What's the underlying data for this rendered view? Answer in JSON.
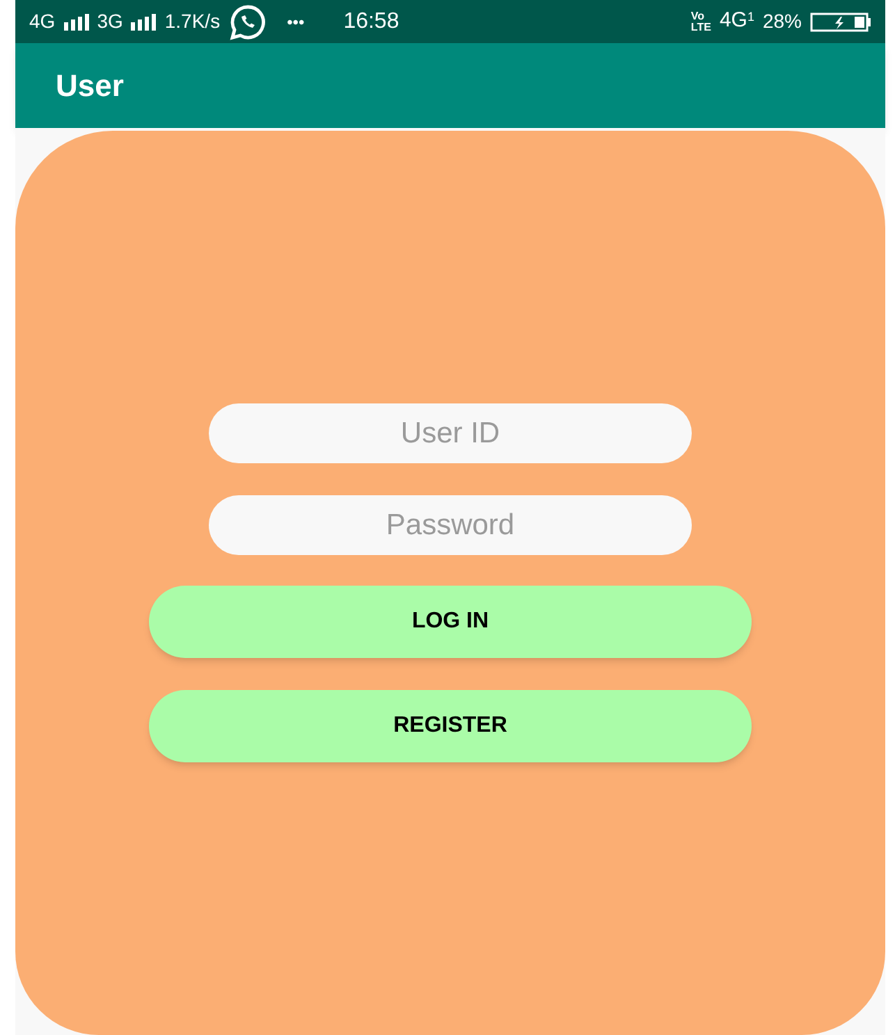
{
  "status_bar": {
    "network_1": "4G",
    "network_2": "3G",
    "speed": "1.7K/s",
    "more": "•••",
    "time": "16:58",
    "volte_top": "Vo",
    "volte_bottom": "LTE",
    "data_network": "4G",
    "sim": "1",
    "battery": "28%"
  },
  "app_bar": {
    "title": "User"
  },
  "form": {
    "fields": [
      {
        "placeholder": "User ID"
      },
      {
        "placeholder": "Password"
      }
    ],
    "buttons": [
      "LOG IN",
      "REGISTER"
    ]
  }
}
